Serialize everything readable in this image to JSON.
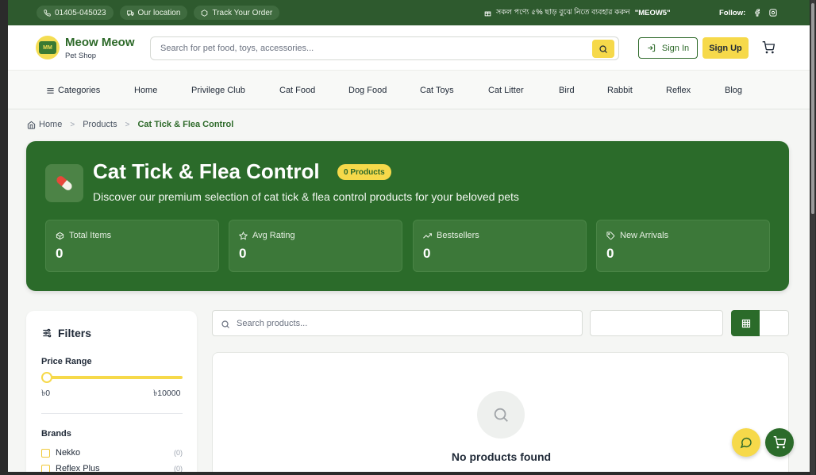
{
  "topbar": {
    "phone": "01405-045023",
    "location": "Our location",
    "track": "Track Your Order",
    "promo_text": "সকল পণ্যে ৫% ছাড় বুঝে নিতে ব্যবহার করুন",
    "promo_code": "\"MEOW5\"",
    "follow_label": "Follow:"
  },
  "header": {
    "brand_name": "Meow Meow",
    "brand_sub": "Pet Shop",
    "search_placeholder": "Search for pet food, toys, accessories...",
    "signin_label": "Sign In",
    "signup_label": "Sign Up"
  },
  "nav": {
    "categories": "Categories",
    "items": [
      "Home",
      "Privilege Club",
      "Cat Food",
      "Dog Food",
      "Cat Toys",
      "Cat Litter",
      "Bird",
      "Rabbit",
      "Reflex",
      "Blog"
    ]
  },
  "breadcrumb": {
    "home": "Home",
    "products": "Products",
    "current": "Cat Tick & Flea Control",
    "sep": ">"
  },
  "hero": {
    "title": "Cat Tick & Flea Control",
    "badge": "0 Products",
    "description": "Discover our premium selection of cat tick & flea control products for your beloved pets",
    "stats": [
      {
        "label": "Total Items",
        "value": "0",
        "icon": "box-icon"
      },
      {
        "label": "Avg Rating",
        "value": "0",
        "icon": "star-icon"
      },
      {
        "label": "Bestsellers",
        "value": "0",
        "icon": "trend-up-icon"
      },
      {
        "label": "New Arrivals",
        "value": "0",
        "icon": "tag-icon"
      }
    ]
  },
  "filters": {
    "title": "Filters",
    "price_range_label": "Price Range",
    "price_min": "৳0",
    "price_max": "৳10000",
    "brands_label": "Brands",
    "brands": [
      {
        "name": "Nekko",
        "count": "(0)"
      },
      {
        "name": "Reflex Plus",
        "count": "(0)"
      }
    ]
  },
  "products": {
    "search_placeholder": "Search products...",
    "empty_text": "No products found"
  },
  "colors": {
    "primary_green": "#2b6b2a",
    "accent_yellow": "#f6d94a",
    "topbar_green": "#2e5a2e"
  }
}
